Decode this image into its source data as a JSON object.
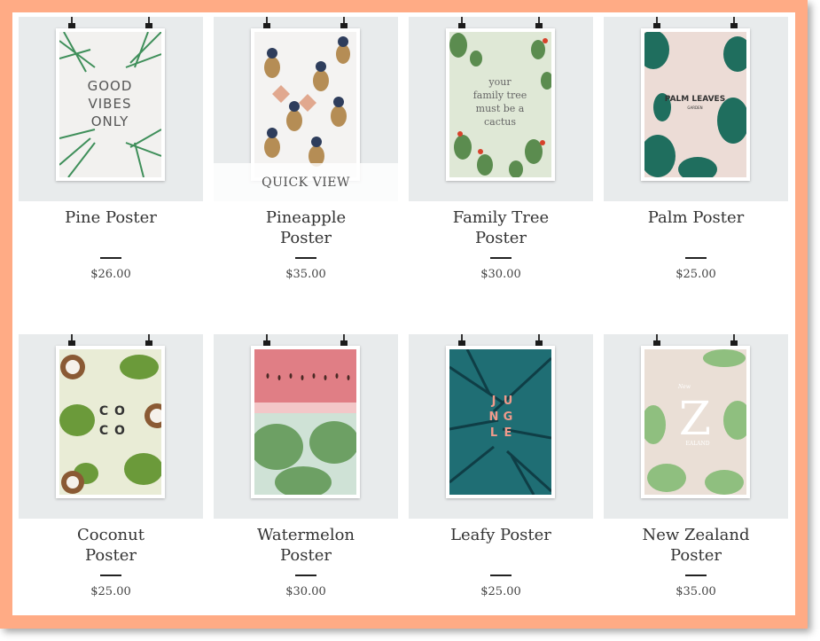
{
  "gallery": {
    "quick_view_label": "QUICK VIEW",
    "products": [
      {
        "name_line1": "Pine Poster",
        "name_line2": "",
        "price": "$26.00",
        "poster_text": [
          "GOOD",
          "VIBES",
          "ONLY"
        ]
      },
      {
        "name_line1": "Pineapple",
        "name_line2": "Poster",
        "price": "$35.00",
        "poster_text": []
      },
      {
        "name_line1": "Family Tree",
        "name_line2": "Poster",
        "price": "$30.00",
        "poster_text": [
          "your",
          "family tree",
          "must be a",
          "cactus"
        ]
      },
      {
        "name_line1": "Palm Poster",
        "name_line2": "",
        "price": "$25.00",
        "poster_text": [
          "PALM LEAVES",
          "GARDEN"
        ]
      },
      {
        "name_line1": "Coconut",
        "name_line2": "Poster",
        "price": "$25.00",
        "poster_text": [
          "C",
          "O",
          "C",
          "O"
        ]
      },
      {
        "name_line1": "Watermelon",
        "name_line2": "Poster",
        "price": "$30.00",
        "poster_text": []
      },
      {
        "name_line1": "Leafy Poster",
        "name_line2": "",
        "price": "$25.00",
        "poster_text": [
          "J",
          "U",
          "N",
          "G",
          "L",
          "E"
        ]
      },
      {
        "name_line1": "New Zealand",
        "name_line2": "Poster",
        "price": "$35.00",
        "poster_text": [
          "New",
          "Z",
          "EALAND"
        ]
      }
    ]
  },
  "colors": {
    "frame": "#ffab85",
    "thumb_bg": "#e8ebec",
    "leaf_green": "#3f8f5a",
    "teal": "#1f6e74"
  }
}
